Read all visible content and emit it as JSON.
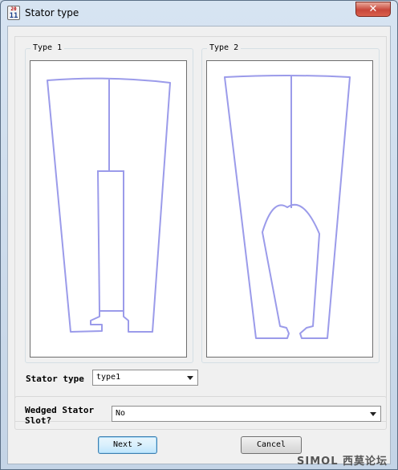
{
  "window": {
    "title": "Stator type",
    "icon_text_top": "20",
    "icon_text_bottom": "11",
    "close_label": "✕"
  },
  "types": {
    "type1_label": "Type 1",
    "type2_label": "Type 2"
  },
  "stator_type": {
    "label": "Stator type",
    "selected": "type1"
  },
  "wedged": {
    "label_line1": "Wedged Stator",
    "label_line2": "Slot?",
    "selected": "No"
  },
  "buttons": {
    "next_label": "Next >",
    "cancel_label": "Cancel"
  },
  "watermark": "SIMOL 西莫论坛",
  "colors": {
    "outline": "#9b9bea",
    "close_button": "#c8473a",
    "default_button_border": "#3c7fb1"
  }
}
